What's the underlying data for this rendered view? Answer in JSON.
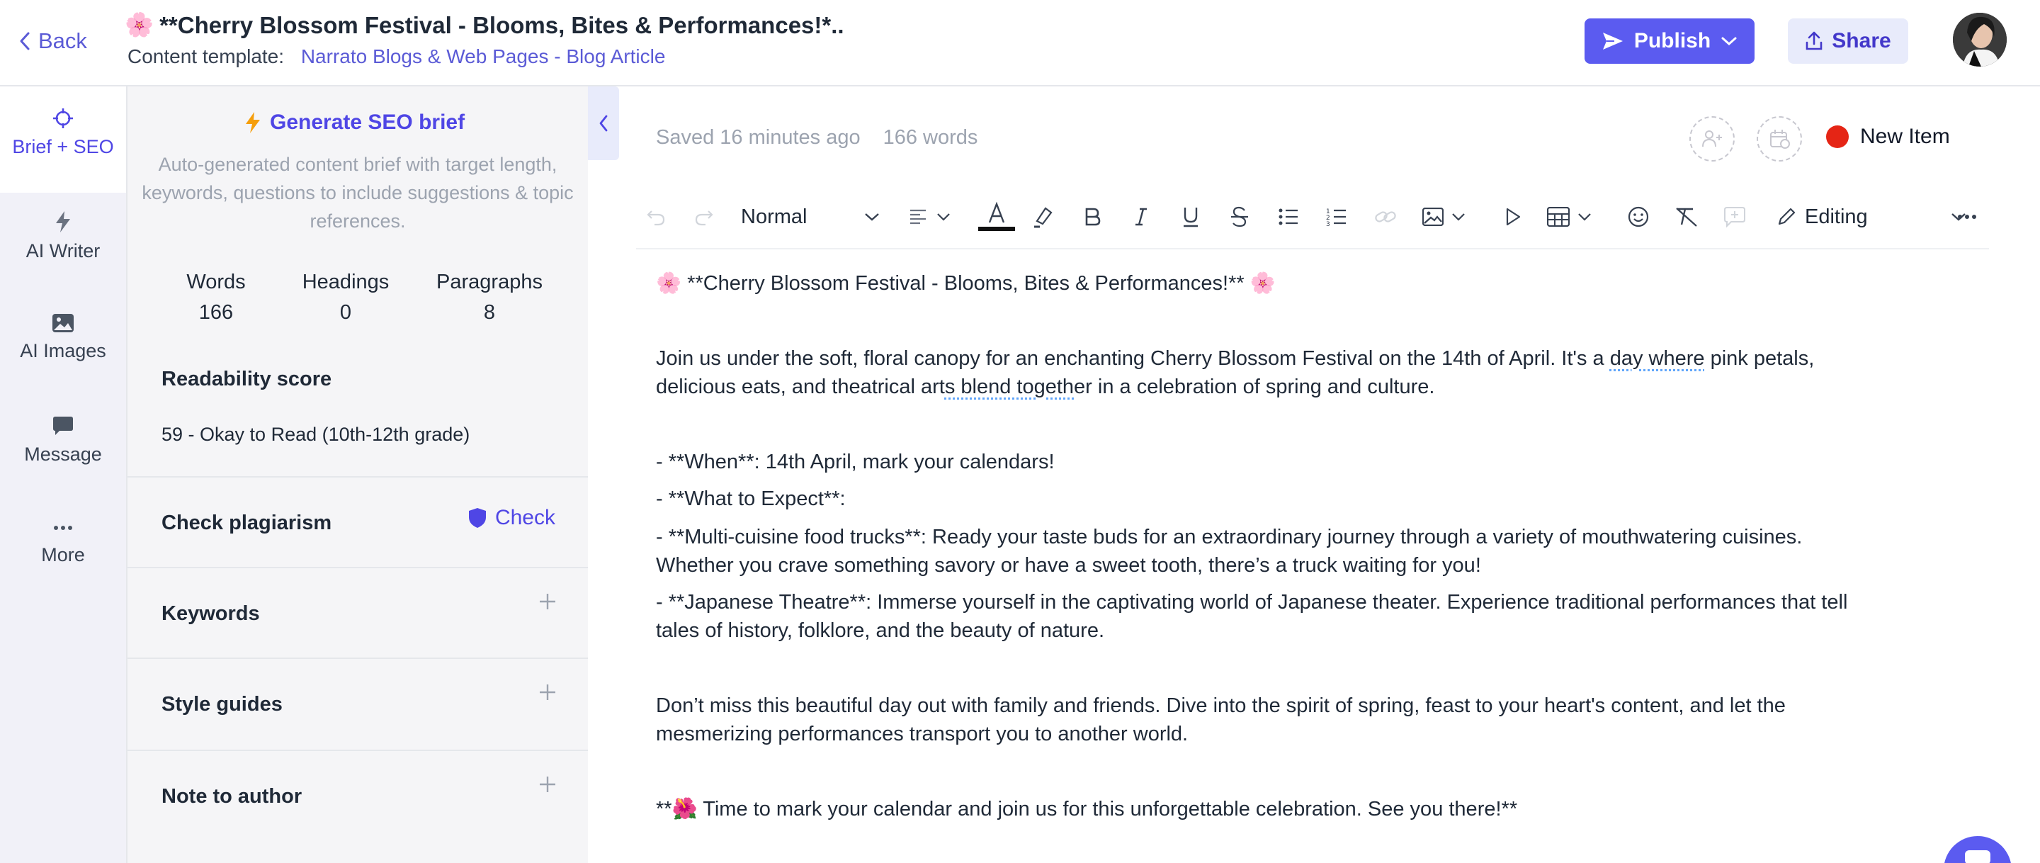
{
  "header": {
    "back_label": "Back",
    "title_emoji": "🌸",
    "title": "**Cherry Blossom Festival - Blooms, Bites & Performances!*..",
    "template_label": "Content template:",
    "template_value": "Narrato Blogs & Web Pages - Blog Article",
    "publish_label": "Publish",
    "share_label": "Share"
  },
  "colors": {
    "accent": "#5b5bf0",
    "accent_text": "#4f46e5",
    "status_red": "#e52515"
  },
  "leftnav": {
    "items": [
      {
        "label": "Brief + SEO",
        "icon": "crosshair-icon",
        "active": true
      },
      {
        "label": "AI Writer",
        "icon": "lightning-icon"
      },
      {
        "label": "AI Images",
        "icon": "image-icon"
      },
      {
        "label": "Message",
        "icon": "chat-icon"
      },
      {
        "label": "More",
        "icon": "more-dots-icon"
      }
    ]
  },
  "brief": {
    "seo_button": "Generate SEO brief",
    "seo_desc": "Auto-generated content brief with target length, keywords, questions to include suggestions & topic references.",
    "stats": [
      {
        "label": "Words",
        "value": "166"
      },
      {
        "label": "Headings",
        "value": "0"
      },
      {
        "label": "Paragraphs",
        "value": "8"
      }
    ],
    "readability_title": "Readability score",
    "readability_value": "59 - Okay to Read (10th-12th grade)",
    "plagiarism_title": "Check plagiarism",
    "plagiarism_action": "Check",
    "sections": [
      "Keywords",
      "Style guides",
      "Note to author"
    ]
  },
  "editor": {
    "saved_status": "Saved 16 minutes ago",
    "word_count": "166 words",
    "new_item_label": "New Item",
    "style_select": "Normal",
    "editing_mode": "Editing",
    "content": {
      "heading": "🌸 **Cherry Blossom Festival - Blooms, Bites & Performances!** 🌸",
      "intro_a": "Join us under the soft, floral canopy for an enchanting Cherry Blossom Festival on the 14th of April. It's a ",
      "intro_b": "day where",
      "intro_c": " pink petals,",
      "intro_d": "delicious eats, and theatrical art",
      "intro_e": "s blend togeth",
      "intro_f": "er in a celebration of spring and culture.",
      "when": "- **When**: 14th April, mark your calendars!",
      "what": "- **What to Expect**:",
      "food_1": "- **Multi-cuisine food trucks**: Ready your taste buds for an extraordinary journey through a variety of mouthwatering cuisines.",
      "food_2": "Whether you crave something savory or have a sweet tooth, there’s a truck waiting for you!",
      "theatre_1": "- **Japanese Theatre**: Immerse yourself in the captivating world of Japanese theater. Experience traditional performances that tell",
      "theatre_2": "tales of history, folklore, and the beauty of nature.",
      "dont_1": "Don’t miss this beautiful day out with family and friends. Dive into the spirit of spring, feast to your heart's content, and let the",
      "dont_2": "mesmerizing performances transport you to another world.",
      "closing": "**🌺 Time to mark your calendar and join us for this unforgettable celebration. See you there!**"
    }
  }
}
